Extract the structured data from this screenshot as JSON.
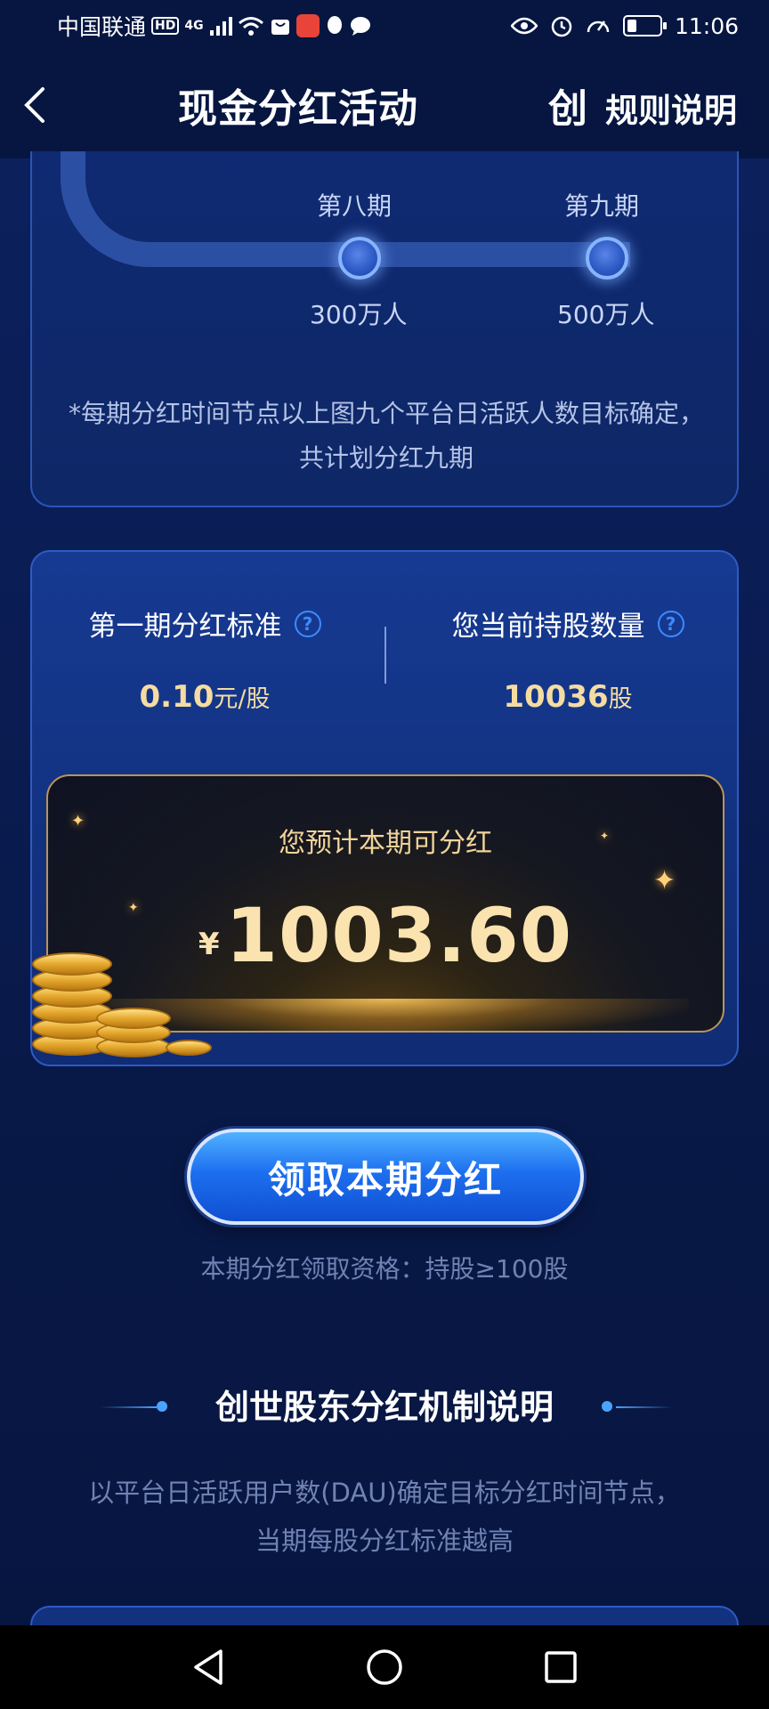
{
  "status_bar": {
    "carrier": "中国联通",
    "hd_badge": "HD",
    "network": "4G",
    "time": "11:06"
  },
  "header": {
    "title": "现金分红活动",
    "brand_glyph": "创",
    "rules_label": "规则说明"
  },
  "timeline": {
    "nodes": [
      {
        "period": "第八期",
        "users": "300万人"
      },
      {
        "period": "第九期",
        "users": "500万人"
      }
    ],
    "note": "*每期分红时间节点以上图九个平台日活跃人数目标确定，共计划分红九期"
  },
  "dividend": {
    "standard_label": "第一期分红标准",
    "standard_value": "0.10",
    "standard_unit": "元/股",
    "holdings_label": "您当前持股数量",
    "holdings_value": "10036",
    "holdings_unit": "股",
    "help_glyph": "?",
    "estimate_label": "您预计本期可分红",
    "currency_symbol": "¥",
    "estimate_amount": "1003.60"
  },
  "claim": {
    "button_label": "领取本期分红",
    "eligibility": "本期分红领取资格：持股≥100股"
  },
  "section": {
    "heading": "创世股东分红机制说明",
    "description": "以平台日活跃用户数(DAU)确定目标分红时间节点，当期每股分红标准越高"
  },
  "colors": {
    "background": "#0a1c52",
    "accent_blue": "#1d6ff0",
    "gold": "#fbe3b0"
  }
}
